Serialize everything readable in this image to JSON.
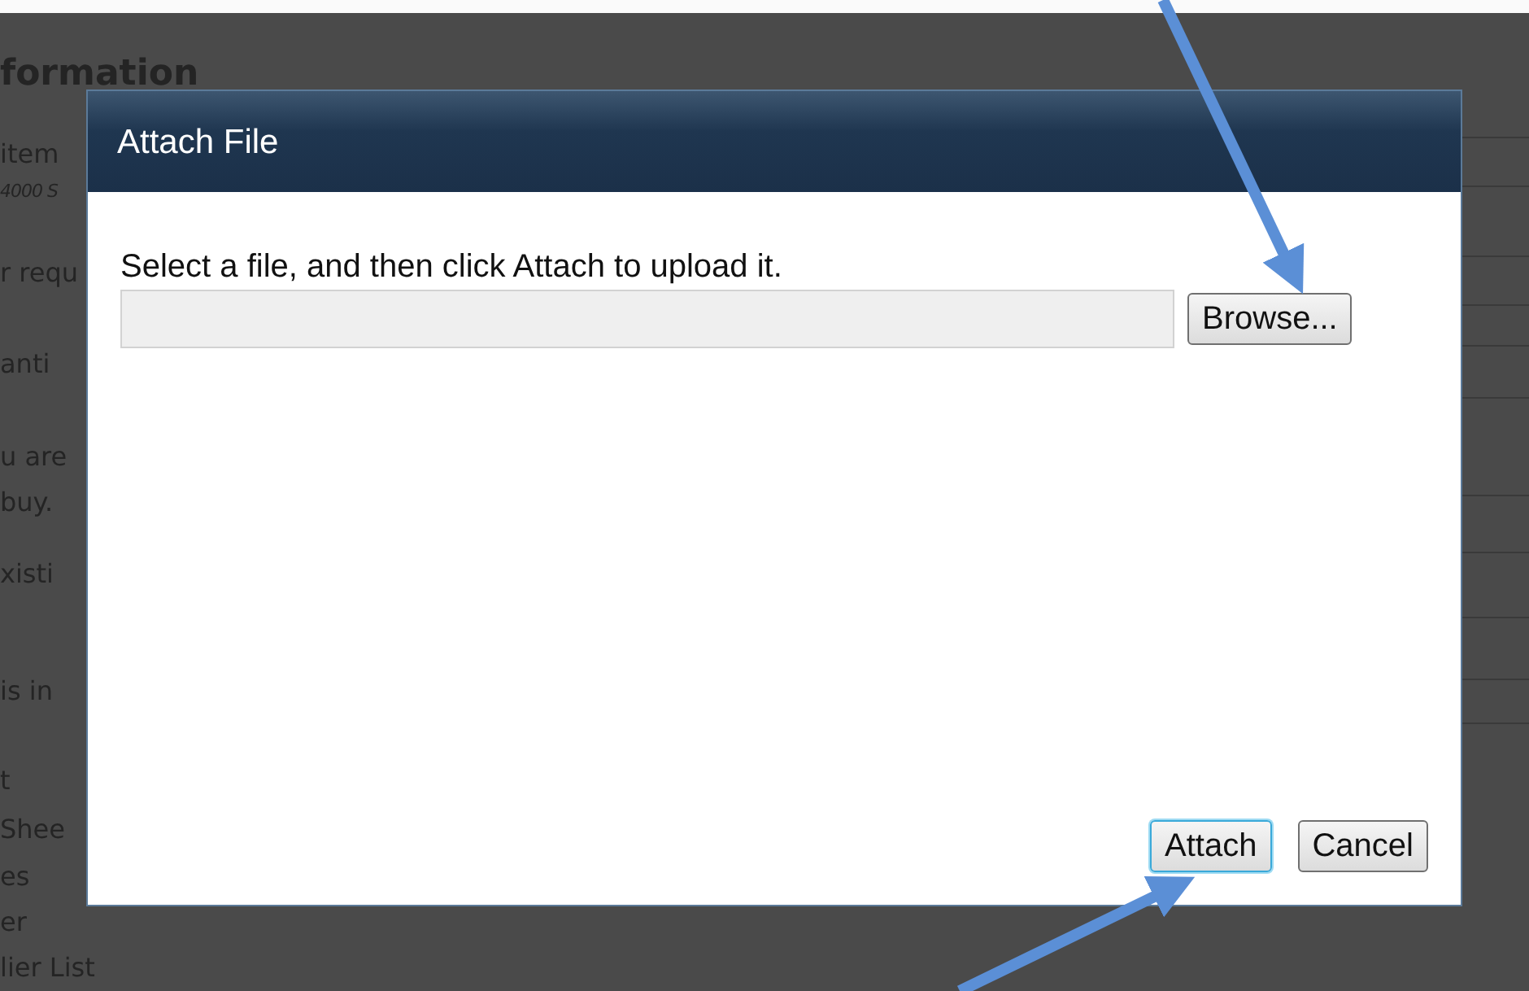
{
  "background_page": {
    "heading": "formation",
    "lines": [
      {
        "text": "item",
        "kind": "plain"
      },
      {
        "text": "4000 S",
        "kind": "note"
      },
      {
        "text": "r requ",
        "kind": "plain"
      },
      {
        "text": "anti",
        "kind": "plain"
      },
      {
        "text": "u are",
        "kind": "plain"
      },
      {
        "text": "buy.",
        "kind": "plain"
      },
      {
        "text": "xisti",
        "kind": "plain"
      },
      {
        "text": "is in",
        "kind": "plain"
      },
      {
        "text": "t",
        "kind": "plain"
      },
      {
        "text": "Shee",
        "kind": "plain"
      },
      {
        "text": "es",
        "kind": "plain"
      },
      {
        "text": "er",
        "kind": "plain"
      },
      {
        "text": "lier List",
        "kind": "plain"
      }
    ]
  },
  "dialog": {
    "title": "Attach File",
    "instruction": "Select a file, and then click Attach to upload it.",
    "file_field": {
      "disabled": true
    },
    "browse_button": "Browse...",
    "buttons": [
      {
        "label": "Attach",
        "focused": true
      },
      {
        "label": "Cancel",
        "focused": false
      }
    ]
  }
}
